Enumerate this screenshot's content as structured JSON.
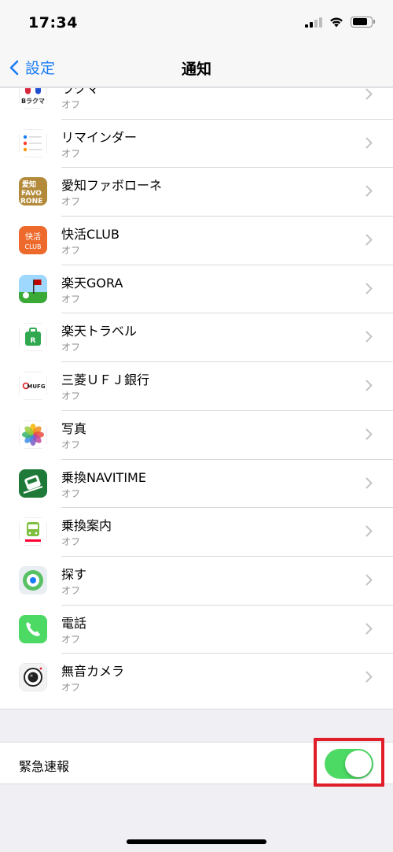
{
  "status_bar": {
    "time": "17:34",
    "icons": [
      "cellular-signal-icon",
      "wifi-icon",
      "battery-icon"
    ],
    "battery_level": 0.8
  },
  "nav": {
    "back_label": "設定",
    "title": "通知"
  },
  "apps": [
    {
      "name": "ラクマ",
      "status": "オフ",
      "icon": "rakuma-icon"
    },
    {
      "name": "リマインダー",
      "status": "オフ",
      "icon": "reminders-icon"
    },
    {
      "name": "愛知ファボローネ",
      "status": "オフ",
      "icon": "favorone-icon",
      "icon_text": "愛知 FAVO RONE"
    },
    {
      "name": "快活CLUB",
      "status": "オフ",
      "icon": "kaikatsu-club-icon",
      "icon_text": "快活 CLUB"
    },
    {
      "name": "楽天GORA",
      "status": "オフ",
      "icon": "rakuten-gora-icon"
    },
    {
      "name": "楽天トラベル",
      "status": "オフ",
      "icon": "rakuten-travel-icon"
    },
    {
      "name": "三菱ＵＦＪ銀行",
      "status": "オフ",
      "icon": "mufg-icon",
      "icon_text": "MUFG"
    },
    {
      "name": "写真",
      "status": "オフ",
      "icon": "photos-icon"
    },
    {
      "name": "乗換NAVITIME",
      "status": "オフ",
      "icon": "navitime-icon"
    },
    {
      "name": "乗換案内",
      "status": "オフ",
      "icon": "norikae-annai-icon"
    },
    {
      "name": "探す",
      "status": "オフ",
      "icon": "find-my-icon"
    },
    {
      "name": "電話",
      "status": "オフ",
      "icon": "phone-icon"
    },
    {
      "name": "無音カメラ",
      "status": "オフ",
      "icon": "silent-camera-icon"
    }
  ],
  "emergency": {
    "label": "緊急速報",
    "enabled": true
  },
  "colors": {
    "accent": "#1a7cf5",
    "toggle_on": "#4cd964",
    "highlight": "#e01e2a"
  }
}
